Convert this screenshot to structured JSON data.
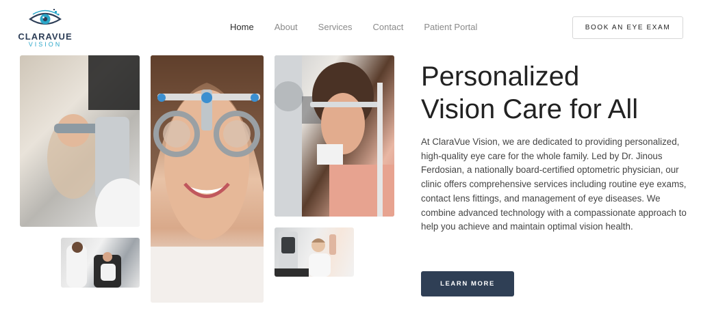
{
  "brand": {
    "name": "CLARAVUE",
    "sub": "VISION",
    "accent": "#2aa7c9",
    "primary": "#2f3f55"
  },
  "nav": {
    "items": [
      "Home",
      "About",
      "Services",
      "Contact",
      "Patient Portal"
    ],
    "active": "Home"
  },
  "header": {
    "cta_label": "BOOK AN EYE EXAM"
  },
  "hero": {
    "title_line1": "Personalized",
    "title_line2": "Vision Care for All",
    "body": "At ClaraVue Vision, we are dedicated to providing personalized, high-quality eye care for the whole family. Led by Dr. Jinous Ferdosian, a nationally board-certified optometric physician, our clinic offers comprehensive services including routine eye exams, contact lens fittings, and management of eye diseases. We combine advanced technology with a compassionate approach to help you achieve and maintain optimal vision health.",
    "cta_label": "LEARN MORE"
  }
}
